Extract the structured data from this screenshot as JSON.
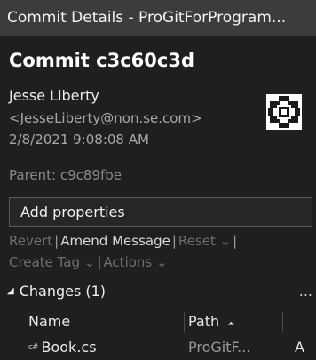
{
  "window": {
    "title": "Commit Details - ProGitForProgram..."
  },
  "commit": {
    "title": "Commit c3c60c3d",
    "author_name": "Jesse Liberty",
    "author_email": "<JesseLiberty@non.se.com>",
    "date": "2/8/2021 9:08:08 AM",
    "parent_label": "Parent:",
    "parent_hash": "c9c89fbe"
  },
  "add_properties_label": "Add properties",
  "actions": {
    "revert": "Revert",
    "amend": "Amend Message",
    "reset": "Reset",
    "create_tag": "Create Tag",
    "actions": "Actions",
    "separator": "|",
    "dropdown_glyph": "⌄"
  },
  "changes": {
    "collapse_glyph": "◢",
    "label": "Changes (1)",
    "more_glyph": "...",
    "columns": {
      "name": "Name",
      "path": "Path",
      "sort_glyph": "⏶"
    },
    "files": [
      {
        "icon_text": "c#",
        "name": "Book.cs",
        "path": "ProGitF...",
        "status": "A"
      }
    ]
  }
}
